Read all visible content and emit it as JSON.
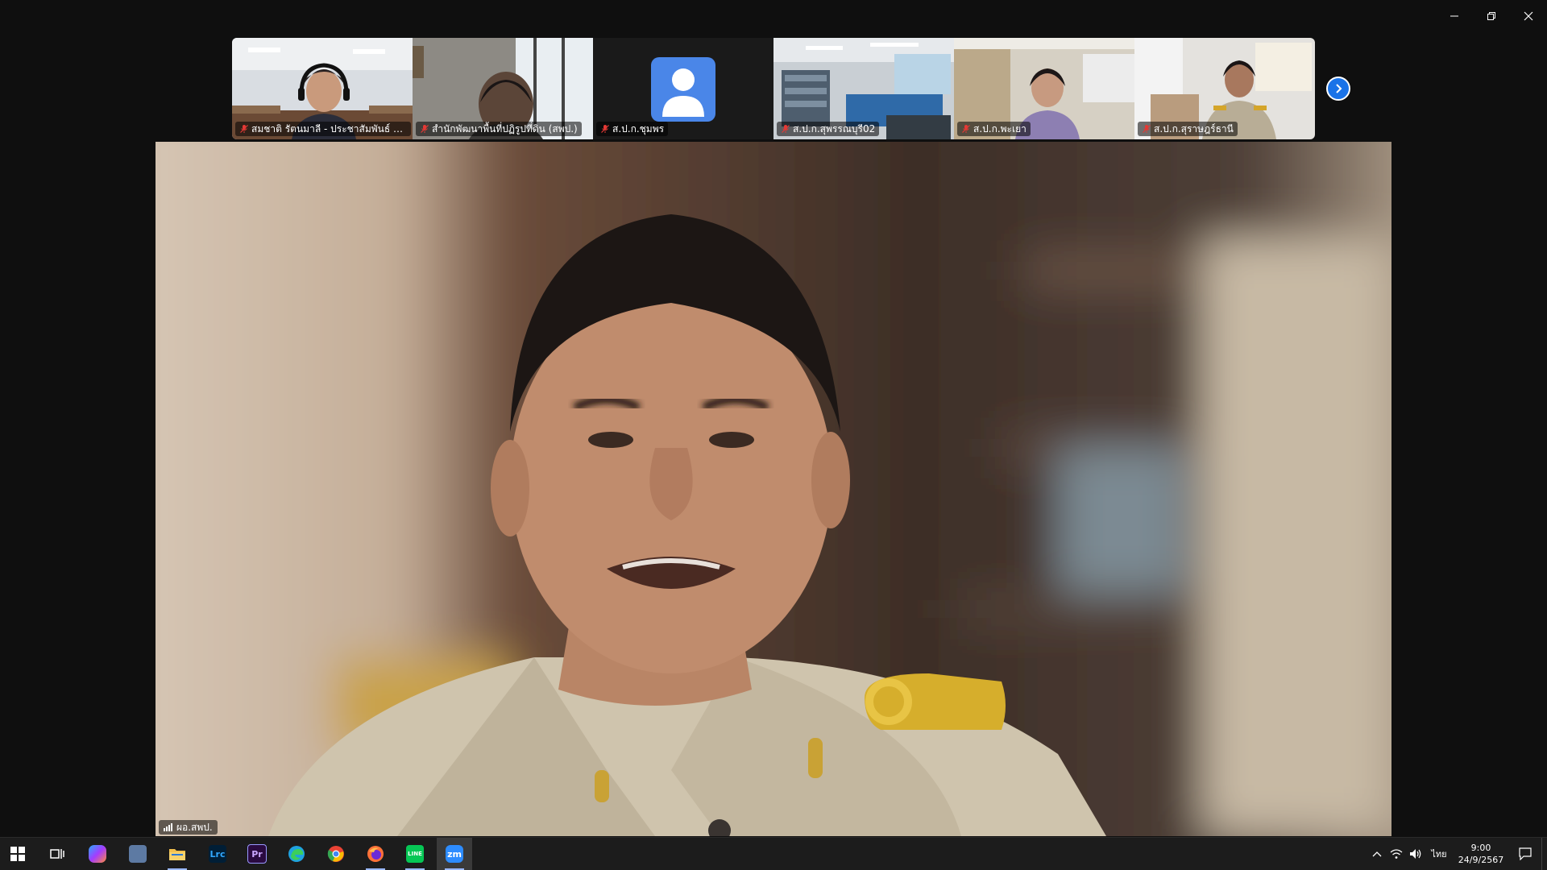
{
  "window": {
    "controls": [
      {
        "name": "minimize-button",
        "icon": "minimize-icon"
      },
      {
        "name": "restore-button",
        "icon": "restore-icon"
      },
      {
        "name": "close-button",
        "icon": "close-icon"
      }
    ]
  },
  "gallery": {
    "tiles": [
      {
        "name": "สมชาติ รัตนมาลี - ประชาสัมพันธ์ ส.ป...",
        "muted": true,
        "video": true
      },
      {
        "name": "สำนักพัฒนาพื้นที่ปฏิรูปที่ดิน (สพป.)",
        "muted": true,
        "video": true
      },
      {
        "name": "ส.ป.ก.ชุมพร",
        "muted": true,
        "video": false
      },
      {
        "name": "ส.ป.ก.สุพรรณบุรี02",
        "muted": true,
        "video": true
      },
      {
        "name": "ส.ป.ก.พะเยา",
        "muted": true,
        "video": true
      },
      {
        "name": "ส.ป.ก.สุราษฎร์ธานี",
        "muted": true,
        "video": true
      }
    ],
    "next_icon": "chevron-right-icon"
  },
  "speaker": {
    "name": "ผอ.สพป.",
    "signal_icon": "signal-bars-icon"
  },
  "taskbar": {
    "apps": [
      {
        "name": "windows-start",
        "label": "",
        "color": "#ffffff"
      },
      {
        "name": "task-view",
        "label": "",
        "color": "#ffffff"
      },
      {
        "name": "copilot",
        "label": "",
        "color": "#7b5cff"
      },
      {
        "name": "app-monitor",
        "label": "",
        "color": "#9fb7d6"
      },
      {
        "name": "file-explorer",
        "label": "",
        "color": "#f2c14e"
      },
      {
        "name": "lightroom-classic",
        "label": "Lrc",
        "color": "#31a8ff"
      },
      {
        "name": "premiere-pro",
        "label": "Pr",
        "color": "#9999ff"
      },
      {
        "name": "edge",
        "label": "",
        "color": "#1fa2e0"
      },
      {
        "name": "chrome",
        "label": "",
        "color": "#34a853"
      },
      {
        "name": "firefox",
        "label": "",
        "color": "#ff7139"
      },
      {
        "name": "line",
        "label": "LINE",
        "color": "#06c755"
      },
      {
        "name": "zoom",
        "label": "zm",
        "color": "#2d8cff"
      }
    ],
    "tray": {
      "ime": "ไทย",
      "time": "9:00",
      "date": "24/9/2567"
    }
  }
}
